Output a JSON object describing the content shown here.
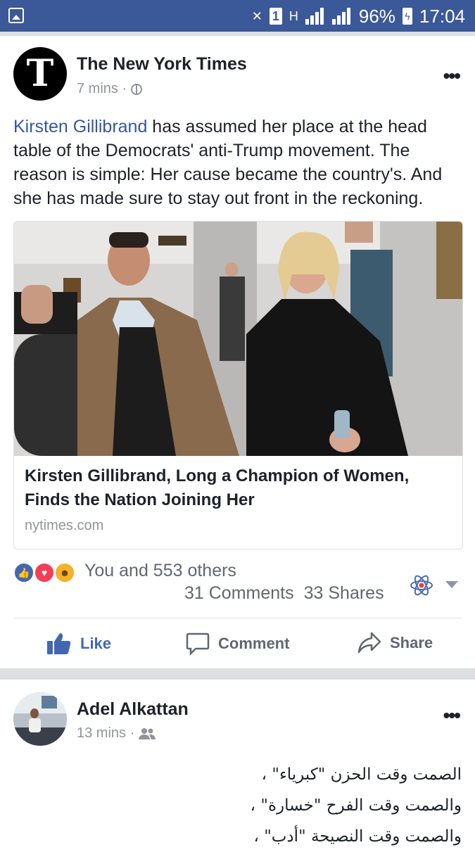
{
  "status_bar": {
    "sim_label": "1",
    "network_label": "H",
    "battery": "96%",
    "time": "17:04"
  },
  "post1": {
    "page_name": "The New York Times",
    "avatar_letter": "T",
    "time": "7 mins ·",
    "text_link": "Kirsten Gillibrand",
    "text_body": " has assumed her place at the head table of the Democrats' anti-Trump movement. The reason is simple: Her cause became the country's. And she has made sure to stay out front in the reckoning.",
    "card": {
      "headline": "Kirsten Gillibrand, Long a Champion of Women, Finds the Nation Joining Her",
      "domain": "nytimes.com"
    },
    "reactions_text": "You and 553 others",
    "comments": "31 Comments",
    "shares": "33 Shares",
    "actions": {
      "like": "Like",
      "comment": "Comment",
      "share": "Share"
    }
  },
  "post2": {
    "author": "Adel Alkattan",
    "time": "13 mins ·",
    "lines": [
      "الصمت وقت الحزن \"كبرياء\" ،",
      "والصمت وقت الفرح \"خسارة\" ،",
      "والصمت وقت النصيحة \"أدب\" ،"
    ]
  },
  "colors": {
    "status_bar": "#3b5998",
    "link": "#365899",
    "like_blue": "#4267b2",
    "love_red": "#f33e58",
    "haha_yellow": "#f7b125",
    "meta_gray": "#90949c"
  }
}
